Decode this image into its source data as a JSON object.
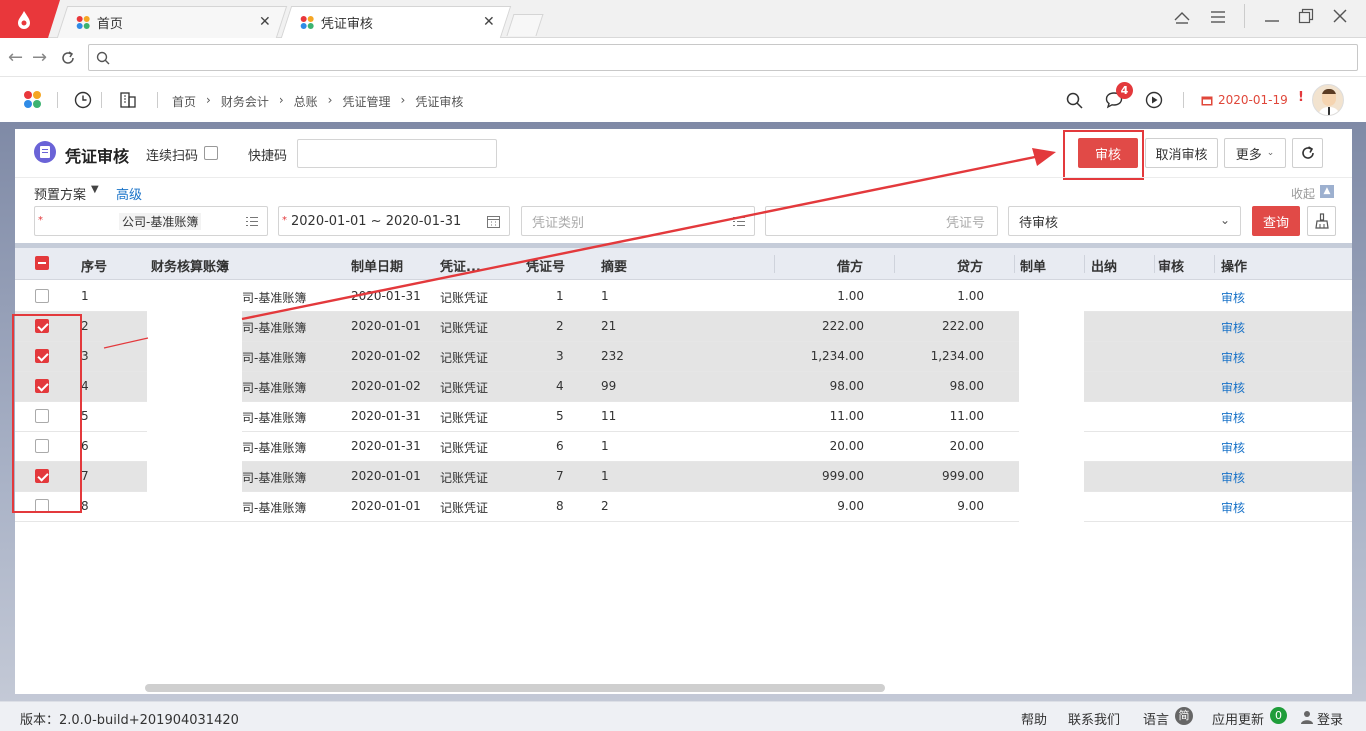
{
  "browser": {
    "tabs": [
      {
        "label": "首页"
      },
      {
        "label": "凭证审核"
      }
    ],
    "url": ""
  },
  "header": {
    "breadcrumb": [
      "首页",
      "财务会计",
      "总账",
      "凭证管理",
      "凭证审核"
    ],
    "notification_count": "4",
    "date": "2020-01-19",
    "exclaim": "!"
  },
  "page": {
    "title": "凭证审核",
    "continuous_scan_label": "连续扫码",
    "quick_code_label": "快捷码",
    "quick_code_value": "",
    "preset_label": "预置方案",
    "advanced_label": "高级",
    "collapse_label": "收起",
    "buttons": {
      "audit": "审核",
      "cancel_audit": "取消审核",
      "more": "更多",
      "query": "查询"
    }
  },
  "filters": {
    "ledger": "公司-基准账簿",
    "date_range": "2020-01-01 ~ 2020-01-31",
    "voucher_type_placeholder": "凭证类别",
    "voucher_no_placeholder": "凭证号",
    "status": "待审核"
  },
  "table": {
    "headers": [
      "序号",
      "财务核算账簿",
      "制单日期",
      "凭证...",
      "凭证号",
      "摘要",
      "借方",
      "贷方",
      "制单",
      "出纳",
      "审核",
      "操作"
    ],
    "rows": [
      {
        "selected": false,
        "no": "1",
        "ledger": "司-基准账簿",
        "date": "2020-01-31",
        "type": "记账凭证",
        "vno": "1",
        "summary": "1",
        "debit": "1.00",
        "credit": "1.00",
        "action": "审核"
      },
      {
        "selected": true,
        "no": "2",
        "ledger": "司-基准账簿",
        "date": "2020-01-01",
        "type": "记账凭证",
        "vno": "2",
        "summary": "21",
        "debit": "222.00",
        "credit": "222.00",
        "action": "审核"
      },
      {
        "selected": true,
        "no": "3",
        "ledger": "司-基准账簿",
        "date": "2020-01-02",
        "type": "记账凭证",
        "vno": "3",
        "summary": "232",
        "debit": "1,234.00",
        "credit": "1,234.00",
        "action": "审核"
      },
      {
        "selected": true,
        "no": "4",
        "ledger": "司-基准账簿",
        "date": "2020-01-02",
        "type": "记账凭证",
        "vno": "4",
        "summary": "99",
        "debit": "98.00",
        "credit": "98.00",
        "action": "审核"
      },
      {
        "selected": false,
        "no": "5",
        "ledger": "司-基准账簿",
        "date": "2020-01-31",
        "type": "记账凭证",
        "vno": "5",
        "summary": "11",
        "debit": "11.00",
        "credit": "11.00",
        "action": "审核"
      },
      {
        "selected": false,
        "no": "6",
        "ledger": "司-基准账簿",
        "date": "2020-01-31",
        "type": "记账凭证",
        "vno": "6",
        "summary": "1",
        "debit": "20.00",
        "credit": "20.00",
        "action": "审核"
      },
      {
        "selected": true,
        "no": "7",
        "ledger": "司-基准账簿",
        "date": "2020-01-01",
        "type": "记账凭证",
        "vno": "7",
        "summary": "1",
        "debit": "999.00",
        "credit": "999.00",
        "action": "审核"
      },
      {
        "selected": false,
        "no": "8",
        "ledger": "司-基准账簿",
        "date": "2020-01-01",
        "type": "记账凭证",
        "vno": "8",
        "summary": "2",
        "debit": "9.00",
        "credit": "9.00",
        "action": "审核"
      }
    ]
  },
  "footer": {
    "version": "版本：2.0.0-build+201904031420",
    "help": "帮助",
    "contact": "联系我们",
    "language": "语言",
    "language_badge": "简",
    "update": "应用更新",
    "update_count": "0",
    "login": "登录"
  },
  "colors": {
    "accent": "#e3393c",
    "link": "#1a73c8",
    "date": "#e0473a"
  }
}
